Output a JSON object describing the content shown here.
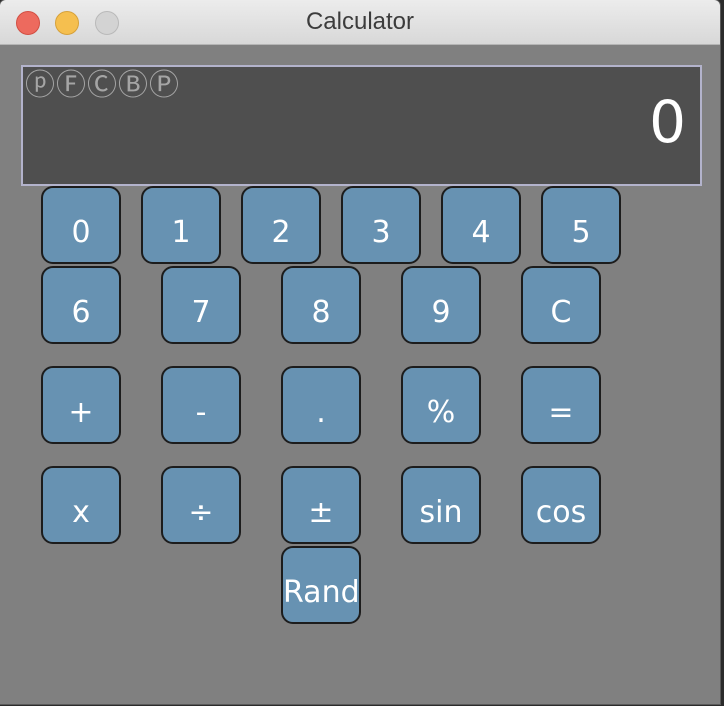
{
  "window": {
    "title": "Calculator"
  },
  "display": {
    "indicators": [
      "ⓟ",
      "Ⓕ",
      "Ⓒ",
      "Ⓑ",
      "Ⓟ"
    ],
    "value": "0"
  },
  "keys": {
    "digit_0": "0",
    "digit_1": "1",
    "digit_2": "2",
    "digit_3": "3",
    "digit_4": "4",
    "digit_5": "5",
    "digit_6": "6",
    "digit_7": "7",
    "digit_8": "8",
    "digit_9": "9",
    "clear": "C",
    "plus": "+",
    "minus": "-",
    "decimal": ".",
    "percent": "%",
    "equals": "=",
    "multiply": "x",
    "divide": "÷",
    "sign": "±",
    "sin": "sin",
    "cos": "cos",
    "rand": "Rand"
  },
  "colors": {
    "window_bg": "#808080",
    "display_bg": "#4f4f4f",
    "display_border": "#b3b3cc",
    "key_bg": "#6792b2",
    "key_border": "#1c1c1c",
    "key_text": "#ffffff",
    "indicator_text": "#a5a5a5"
  }
}
